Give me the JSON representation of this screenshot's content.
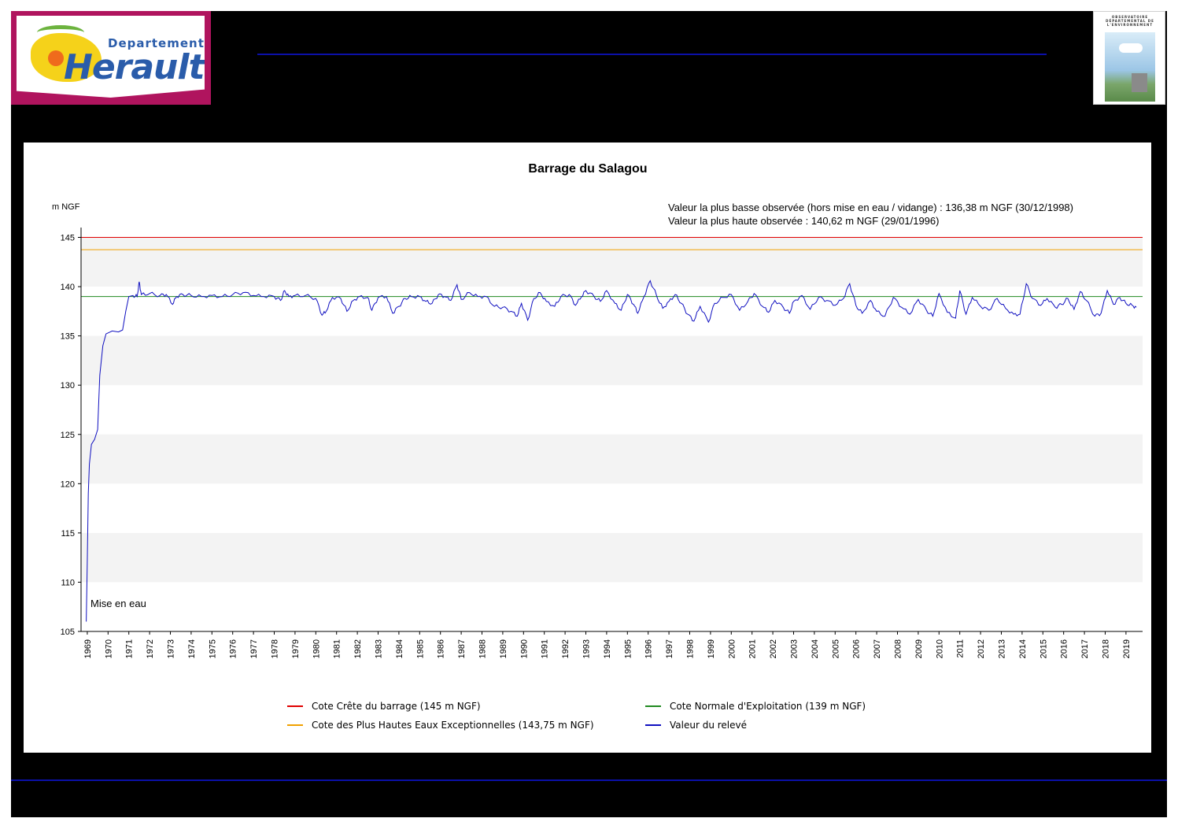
{
  "header": {
    "logo_left": {
      "line1": "Departement",
      "line2": "Herault",
      "colors": {
        "frame": "#b0145e",
        "text": "#2a5caa",
        "sun": "#ef6b1c",
        "land": "#f5d21a"
      }
    },
    "logo_right": {
      "text": "OBSERVATOIRE DÉPARTEMENTAL DE L'ENVIRONNEMENT"
    },
    "rule_color": "#0b10a8"
  },
  "chart_data": {
    "type": "line",
    "title": "Barrage du Salagou",
    "ylabel": "m NGF",
    "xlabel": "",
    "ylim": [
      105,
      146
    ],
    "yticks": [
      105,
      110,
      115,
      120,
      125,
      130,
      135,
      140,
      145
    ],
    "xlim": [
      1968.7,
      2019.8
    ],
    "xtick_labels": [
      "1969",
      "1970",
      "1971",
      "1972",
      "1973",
      "1974",
      "1975",
      "1976",
      "1977",
      "1978",
      "1979",
      "1980",
      "1981",
      "1982",
      "1983",
      "1984",
      "1985",
      "1986",
      "1987",
      "1988",
      "1989",
      "1990",
      "1991",
      "1992",
      "1993",
      "1994",
      "1995",
      "1996",
      "1997",
      "1998",
      "1999",
      "2000",
      "2001",
      "2002",
      "2003",
      "2004",
      "2005",
      "2006",
      "2007",
      "2008",
      "2009",
      "2010",
      "2011",
      "2012",
      "2013",
      "2014",
      "2015",
      "2016",
      "2017",
      "2018",
      "2019"
    ],
    "grid": "alternating horizontal bands",
    "legend_position": "bottom",
    "annotations": {
      "low": "Valeur la plus basse observée (hors mise en eau / vidange) : 136,38 m NGF (30/12/1998)",
      "high": "Valeur la plus haute observée : 140,62 m NGF (29/01/1996)",
      "mise_en_eau": "Mise en eau"
    },
    "reference_lines": [
      {
        "name": "Cote Crête du barrage (145 m NGF)",
        "y": 145,
        "color": "#e00000"
      },
      {
        "name": "Cote des Plus Hautes Eaux Exceptionnelles (143,75 m NGF)",
        "y": 143.75,
        "color": "#f0a000"
      },
      {
        "name": "Cote Normale d'Exploitation (139 m NGF)",
        "y": 139,
        "color": "#208a20"
      }
    ],
    "series": [
      {
        "name": "Valeur du relevé",
        "color": "#1010c0",
        "points": [
          [
            1968.95,
            106
          ],
          [
            1969.0,
            112
          ],
          [
            1969.05,
            119
          ],
          [
            1969.1,
            122
          ],
          [
            1969.2,
            124
          ],
          [
            1969.35,
            124.5
          ],
          [
            1969.5,
            125.5
          ],
          [
            1969.6,
            131
          ],
          [
            1969.75,
            134
          ],
          [
            1969.9,
            135.2
          ],
          [
            1970.2,
            135.5
          ],
          [
            1970.5,
            135.4
          ],
          [
            1970.7,
            135.6
          ],
          [
            1970.85,
            137.5
          ],
          [
            1971.0,
            139.0
          ],
          [
            1971.2,
            139.1
          ],
          [
            1971.4,
            139.0
          ],
          [
            1971.5,
            140.5
          ],
          [
            1971.6,
            139.2
          ],
          [
            1972.0,
            139.3
          ],
          [
            1972.5,
            139.1
          ],
          [
            1972.8,
            139.2
          ],
          [
            1973.1,
            138.2
          ],
          [
            1973.3,
            139.0
          ],
          [
            1973.6,
            139.2
          ],
          [
            1974.0,
            139.1
          ],
          [
            1974.5,
            139.0
          ],
          [
            1975.0,
            139.1
          ],
          [
            1975.5,
            139.0
          ],
          [
            1976.0,
            139.2
          ],
          [
            1976.5,
            139.4
          ],
          [
            1977.0,
            139.1
          ],
          [
            1977.5,
            139.0
          ],
          [
            1978.0,
            139.0
          ],
          [
            1978.3,
            138.6
          ],
          [
            1978.5,
            139.6
          ],
          [
            1978.7,
            139.0
          ],
          [
            1979.0,
            139.1
          ],
          [
            1979.5,
            139.1
          ],
          [
            1980.0,
            138.8
          ],
          [
            1980.3,
            137.1
          ],
          [
            1980.5,
            137.5
          ],
          [
            1980.8,
            138.9
          ],
          [
            1981.2,
            138.8
          ],
          [
            1981.5,
            137.5
          ],
          [
            1981.8,
            138.6
          ],
          [
            1982.1,
            139.0
          ],
          [
            1982.5,
            138.9
          ],
          [
            1982.7,
            137.6
          ],
          [
            1983.0,
            138.9
          ],
          [
            1983.4,
            139.0
          ],
          [
            1983.7,
            137.3
          ],
          [
            1984.0,
            138.0
          ],
          [
            1984.3,
            138.8
          ],
          [
            1984.6,
            139.0
          ],
          [
            1985.0,
            139.0
          ],
          [
            1985.3,
            138.5
          ],
          [
            1985.6,
            138.3
          ],
          [
            1985.9,
            139.2
          ],
          [
            1986.2,
            139.0
          ],
          [
            1986.5,
            138.6
          ],
          [
            1986.8,
            140.2
          ],
          [
            1987.0,
            138.7
          ],
          [
            1987.4,
            139.4
          ],
          [
            1987.8,
            139.0
          ],
          [
            1988.2,
            139.0
          ],
          [
            1988.6,
            138.0
          ],
          [
            1989.0,
            137.9
          ],
          [
            1989.4,
            137.5
          ],
          [
            1989.7,
            137.0
          ],
          [
            1989.9,
            138.3
          ],
          [
            1990.2,
            136.6
          ],
          [
            1990.5,
            138.8
          ],
          [
            1990.8,
            139.4
          ],
          [
            1991.1,
            138.5
          ],
          [
            1991.5,
            138.0
          ],
          [
            1991.8,
            139.0
          ],
          [
            1992.2,
            139.2
          ],
          [
            1992.5,
            138.1
          ],
          [
            1992.8,
            139.0
          ],
          [
            1993.0,
            139.6
          ],
          [
            1993.4,
            139.0
          ],
          [
            1993.7,
            138.5
          ],
          [
            1994.0,
            139.6
          ],
          [
            1994.4,
            138.3
          ],
          [
            1994.7,
            137.6
          ],
          [
            1995.0,
            139.2
          ],
          [
            1995.3,
            138.2
          ],
          [
            1995.5,
            137.3
          ],
          [
            1995.8,
            139.0
          ],
          [
            1996.1,
            140.6
          ],
          [
            1996.4,
            139.1
          ],
          [
            1996.7,
            137.8
          ],
          [
            1997.0,
            138.5
          ],
          [
            1997.3,
            139.2
          ],
          [
            1997.6,
            138.3
          ],
          [
            1997.9,
            137.2
          ],
          [
            1998.2,
            136.5
          ],
          [
            1998.5,
            138.0
          ],
          [
            1998.9,
            136.4
          ],
          [
            1999.2,
            138.3
          ],
          [
            1999.6,
            138.9
          ],
          [
            2000.0,
            139.2
          ],
          [
            2000.4,
            137.6
          ],
          [
            2000.8,
            138.5
          ],
          [
            2001.1,
            139.3
          ],
          [
            2001.5,
            138.0
          ],
          [
            2001.8,
            137.4
          ],
          [
            2002.1,
            138.6
          ],
          [
            2002.5,
            137.9
          ],
          [
            2002.8,
            137.3
          ],
          [
            2003.0,
            138.5
          ],
          [
            2003.4,
            139.1
          ],
          [
            2003.8,
            137.7
          ],
          [
            2004.2,
            138.9
          ],
          [
            2004.6,
            138.6
          ],
          [
            2005.0,
            138.1
          ],
          [
            2005.4,
            138.8
          ],
          [
            2005.7,
            140.3
          ],
          [
            2006.0,
            138.1
          ],
          [
            2006.3,
            137.3
          ],
          [
            2006.7,
            138.6
          ],
          [
            2007.0,
            137.5
          ],
          [
            2007.4,
            137.0
          ],
          [
            2007.8,
            138.9
          ],
          [
            2008.2,
            137.9
          ],
          [
            2008.6,
            137.2
          ],
          [
            2009.0,
            138.7
          ],
          [
            2009.4,
            137.6
          ],
          [
            2009.7,
            137.0
          ],
          [
            2010.0,
            139.3
          ],
          [
            2010.4,
            137.4
          ],
          [
            2010.8,
            136.8
          ],
          [
            2011.0,
            139.6
          ],
          [
            2011.3,
            137.2
          ],
          [
            2011.6,
            138.9
          ],
          [
            2012.0,
            138.0
          ],
          [
            2012.4,
            137.6
          ],
          [
            2012.8,
            138.8
          ],
          [
            2013.2,
            137.8
          ],
          [
            2013.6,
            137.2
          ],
          [
            2013.9,
            137.2
          ],
          [
            2014.2,
            140.3
          ],
          [
            2014.5,
            138.8
          ],
          [
            2014.9,
            138.1
          ],
          [
            2015.2,
            138.8
          ],
          [
            2015.6,
            137.9
          ],
          [
            2015.9,
            138.2
          ],
          [
            2016.2,
            138.8
          ],
          [
            2016.5,
            137.7
          ],
          [
            2016.8,
            139.5
          ],
          [
            2017.1,
            138.6
          ],
          [
            2017.5,
            137.0
          ],
          [
            2017.8,
            137.3
          ],
          [
            2018.1,
            139.6
          ],
          [
            2018.4,
            138.2
          ],
          [
            2018.7,
            138.9
          ],
          [
            2019.0,
            138.3
          ],
          [
            2019.3,
            138.1
          ],
          [
            2019.5,
            137.9
          ]
        ]
      }
    ]
  }
}
